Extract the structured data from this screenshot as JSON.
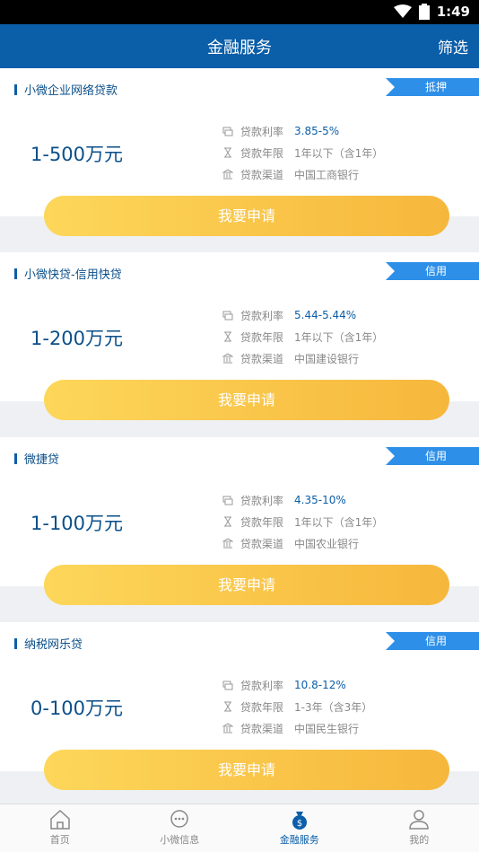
{
  "status": {
    "time": "1:49"
  },
  "nav": {
    "title": "金融服务",
    "filter": "筛选"
  },
  "cards": [
    {
      "name": "小微企业网络贷款",
      "badge": "抵押",
      "amount": "1-500万元",
      "rate_label": "贷款利率",
      "rate": "3.85-5%",
      "term_label": "贷款年限",
      "term": "1年以下（含1年）",
      "channel_label": "贷款渠道",
      "channel": "中国工商银行",
      "apply": "我要申请"
    },
    {
      "name": "小微快贷-信用快贷",
      "badge": "信用",
      "amount": "1-200万元",
      "rate_label": "贷款利率",
      "rate": "5.44-5.44%",
      "term_label": "贷款年限",
      "term": "1年以下（含1年）",
      "channel_label": "贷款渠道",
      "channel": "中国建设银行",
      "apply": "我要申请"
    },
    {
      "name": "微捷贷",
      "badge": "信用",
      "amount": "1-100万元",
      "rate_label": "贷款利率",
      "rate": "4.35-10%",
      "term_label": "贷款年限",
      "term": "1年以下（含1年）",
      "channel_label": "贷款渠道",
      "channel": "中国农业银行",
      "apply": "我要申请"
    },
    {
      "name": "纳税网乐贷",
      "badge": "信用",
      "amount": "0-100万元",
      "rate_label": "贷款利率",
      "rate": "10.8-12%",
      "term_label": "贷款年限",
      "term": "1-3年（含3年）",
      "channel_label": "贷款渠道",
      "channel": "中国民生银行",
      "apply": "我要申请"
    }
  ],
  "tabs": [
    {
      "label": "首页",
      "icon": "home-icon"
    },
    {
      "label": "小微信息",
      "icon": "chat-icon"
    },
    {
      "label": "金融服务",
      "icon": "money-bag-icon",
      "active": true
    },
    {
      "label": "我的",
      "icon": "person-icon"
    }
  ],
  "colors": {
    "primary": "#0b5ea8",
    "badge": "#2d8fe8",
    "button_start": "#fdd75a",
    "button_end": "#f6b73c"
  }
}
